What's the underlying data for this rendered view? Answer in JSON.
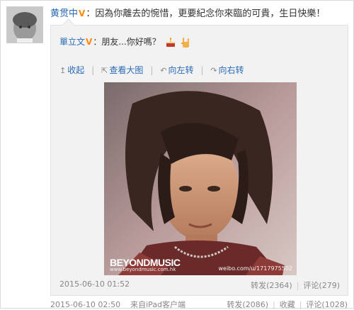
{
  "post": {
    "author": "黄贯中",
    "text": "：因為你離去的惋惜，更要紀念你來臨的可貴，生日快樂！",
    "time": "2015-06-10 02:50",
    "source": "来自iPad客户端",
    "repost_label": "转发(2086)",
    "fav_label": "收藏",
    "comment_label": "评论(1028)"
  },
  "original": {
    "author": "單立文",
    "text": "：朋友...你好嗎？",
    "time": "2015-06-10 01:52",
    "repost_label": "转发(2364)",
    "comment_label": "评论(279)"
  },
  "toolbar": {
    "collapse": "收起",
    "view_large": "查看大图",
    "rotate_left": "向左转",
    "rotate_right": "向右转"
  },
  "photo": {
    "logo_text": "BEYONDMUSIC",
    "logo_url": "www.beyondmusic.com.hk",
    "watermark": "weibo.com/u/1717975502"
  },
  "colors": {
    "link": "#2a6ab7",
    "verified": "#ff8a00",
    "muted": "#888888"
  },
  "icons": {
    "verified": "verified-v-icon",
    "cake": "cake-icon",
    "hand": "rock-hand-icon"
  }
}
